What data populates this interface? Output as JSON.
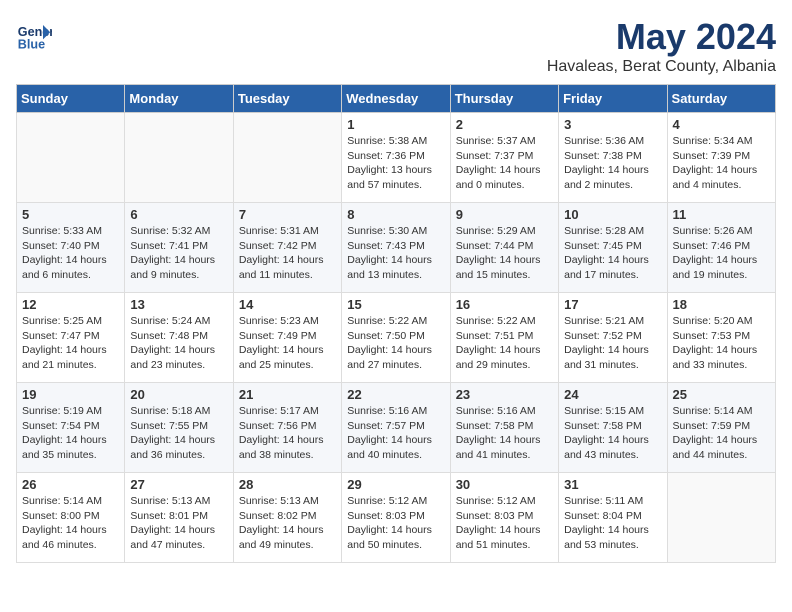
{
  "header": {
    "logo_line1": "General",
    "logo_line2": "Blue",
    "month": "May 2024",
    "location": "Havaleas, Berat County, Albania"
  },
  "weekdays": [
    "Sunday",
    "Monday",
    "Tuesday",
    "Wednesday",
    "Thursday",
    "Friday",
    "Saturday"
  ],
  "weeks": [
    [
      {
        "day": "",
        "info": ""
      },
      {
        "day": "",
        "info": ""
      },
      {
        "day": "",
        "info": ""
      },
      {
        "day": "1",
        "info": "Sunrise: 5:38 AM\nSunset: 7:36 PM\nDaylight: 13 hours\nand 57 minutes."
      },
      {
        "day": "2",
        "info": "Sunrise: 5:37 AM\nSunset: 7:37 PM\nDaylight: 14 hours\nand 0 minutes."
      },
      {
        "day": "3",
        "info": "Sunrise: 5:36 AM\nSunset: 7:38 PM\nDaylight: 14 hours\nand 2 minutes."
      },
      {
        "day": "4",
        "info": "Sunrise: 5:34 AM\nSunset: 7:39 PM\nDaylight: 14 hours\nand 4 minutes."
      }
    ],
    [
      {
        "day": "5",
        "info": "Sunrise: 5:33 AM\nSunset: 7:40 PM\nDaylight: 14 hours\nand 6 minutes."
      },
      {
        "day": "6",
        "info": "Sunrise: 5:32 AM\nSunset: 7:41 PM\nDaylight: 14 hours\nand 9 minutes."
      },
      {
        "day": "7",
        "info": "Sunrise: 5:31 AM\nSunset: 7:42 PM\nDaylight: 14 hours\nand 11 minutes."
      },
      {
        "day": "8",
        "info": "Sunrise: 5:30 AM\nSunset: 7:43 PM\nDaylight: 14 hours\nand 13 minutes."
      },
      {
        "day": "9",
        "info": "Sunrise: 5:29 AM\nSunset: 7:44 PM\nDaylight: 14 hours\nand 15 minutes."
      },
      {
        "day": "10",
        "info": "Sunrise: 5:28 AM\nSunset: 7:45 PM\nDaylight: 14 hours\nand 17 minutes."
      },
      {
        "day": "11",
        "info": "Sunrise: 5:26 AM\nSunset: 7:46 PM\nDaylight: 14 hours\nand 19 minutes."
      }
    ],
    [
      {
        "day": "12",
        "info": "Sunrise: 5:25 AM\nSunset: 7:47 PM\nDaylight: 14 hours\nand 21 minutes."
      },
      {
        "day": "13",
        "info": "Sunrise: 5:24 AM\nSunset: 7:48 PM\nDaylight: 14 hours\nand 23 minutes."
      },
      {
        "day": "14",
        "info": "Sunrise: 5:23 AM\nSunset: 7:49 PM\nDaylight: 14 hours\nand 25 minutes."
      },
      {
        "day": "15",
        "info": "Sunrise: 5:22 AM\nSunset: 7:50 PM\nDaylight: 14 hours\nand 27 minutes."
      },
      {
        "day": "16",
        "info": "Sunrise: 5:22 AM\nSunset: 7:51 PM\nDaylight: 14 hours\nand 29 minutes."
      },
      {
        "day": "17",
        "info": "Sunrise: 5:21 AM\nSunset: 7:52 PM\nDaylight: 14 hours\nand 31 minutes."
      },
      {
        "day": "18",
        "info": "Sunrise: 5:20 AM\nSunset: 7:53 PM\nDaylight: 14 hours\nand 33 minutes."
      }
    ],
    [
      {
        "day": "19",
        "info": "Sunrise: 5:19 AM\nSunset: 7:54 PM\nDaylight: 14 hours\nand 35 minutes."
      },
      {
        "day": "20",
        "info": "Sunrise: 5:18 AM\nSunset: 7:55 PM\nDaylight: 14 hours\nand 36 minutes."
      },
      {
        "day": "21",
        "info": "Sunrise: 5:17 AM\nSunset: 7:56 PM\nDaylight: 14 hours\nand 38 minutes."
      },
      {
        "day": "22",
        "info": "Sunrise: 5:16 AM\nSunset: 7:57 PM\nDaylight: 14 hours\nand 40 minutes."
      },
      {
        "day": "23",
        "info": "Sunrise: 5:16 AM\nSunset: 7:58 PM\nDaylight: 14 hours\nand 41 minutes."
      },
      {
        "day": "24",
        "info": "Sunrise: 5:15 AM\nSunset: 7:58 PM\nDaylight: 14 hours\nand 43 minutes."
      },
      {
        "day": "25",
        "info": "Sunrise: 5:14 AM\nSunset: 7:59 PM\nDaylight: 14 hours\nand 44 minutes."
      }
    ],
    [
      {
        "day": "26",
        "info": "Sunrise: 5:14 AM\nSunset: 8:00 PM\nDaylight: 14 hours\nand 46 minutes."
      },
      {
        "day": "27",
        "info": "Sunrise: 5:13 AM\nSunset: 8:01 PM\nDaylight: 14 hours\nand 47 minutes."
      },
      {
        "day": "28",
        "info": "Sunrise: 5:13 AM\nSunset: 8:02 PM\nDaylight: 14 hours\nand 49 minutes."
      },
      {
        "day": "29",
        "info": "Sunrise: 5:12 AM\nSunset: 8:03 PM\nDaylight: 14 hours\nand 50 minutes."
      },
      {
        "day": "30",
        "info": "Sunrise: 5:12 AM\nSunset: 8:03 PM\nDaylight: 14 hours\nand 51 minutes."
      },
      {
        "day": "31",
        "info": "Sunrise: 5:11 AM\nSunset: 8:04 PM\nDaylight: 14 hours\nand 53 minutes."
      },
      {
        "day": "",
        "info": ""
      }
    ]
  ]
}
